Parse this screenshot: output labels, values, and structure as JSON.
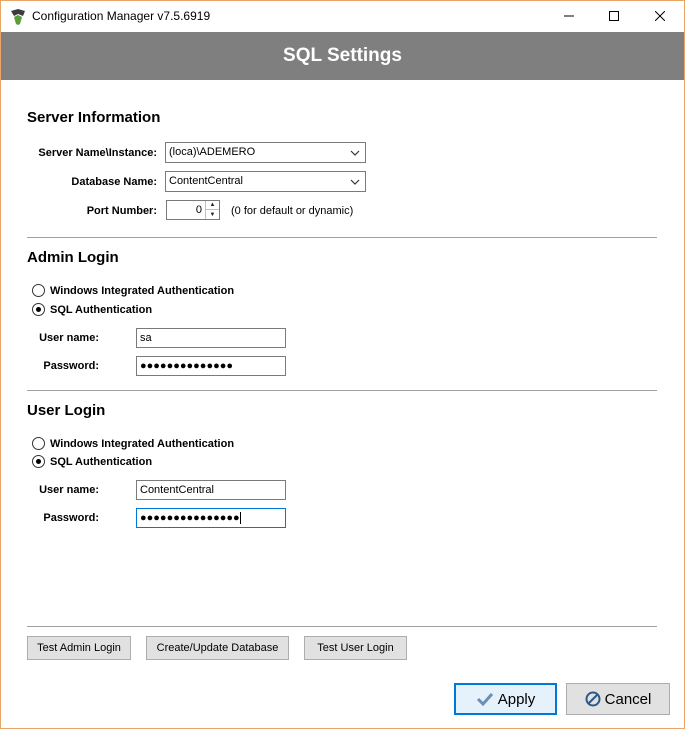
{
  "window": {
    "title": "Configuration Manager v7.5.6919"
  },
  "header": {
    "title": "SQL Settings"
  },
  "server_information": {
    "section_title": "Server Information",
    "server_name_label": "Server Name\\Instance:",
    "server_name_value": "(loca)\\ADEMERO",
    "database_name_label": "Database Name:",
    "database_name_value": "ContentCentral",
    "port_number_label": "Port Number:",
    "port_number_value": "0",
    "port_hint": "(0 for default or dynamic)"
  },
  "admin_login": {
    "section_title": "Admin Login",
    "option_windows": "Windows Integrated Authentication",
    "option_sql": "SQL Authentication",
    "selected": "sql",
    "username_label": "User name:",
    "username_value": "sa",
    "password_label": "Password:",
    "password_mask": "●●●●●●●●●●●●●●"
  },
  "user_login": {
    "section_title": "User Login",
    "option_windows": "Windows Integrated Authentication",
    "option_sql": "SQL Authentication",
    "selected": "sql",
    "username_label": "User name:",
    "username_value": "ContentCentral",
    "password_label": "Password:",
    "password_mask": "●●●●●●●●●●●●●●●"
  },
  "actions": {
    "test_admin_login": "Test Admin Login",
    "create_update_database": "Create/Update Database",
    "test_user_login": "Test User Login",
    "apply": "Apply",
    "cancel": "Cancel"
  },
  "icons": {
    "app": "app-logo-icon",
    "minimize": "minimize-icon",
    "maximize": "maximize-icon",
    "close": "close-icon",
    "apply": "checkmark-icon",
    "cancel": "prohibited-icon"
  },
  "colors": {
    "header_bg": "#7f7f7f",
    "focus_border": "#0078d7",
    "window_border": "#e9a566"
  }
}
